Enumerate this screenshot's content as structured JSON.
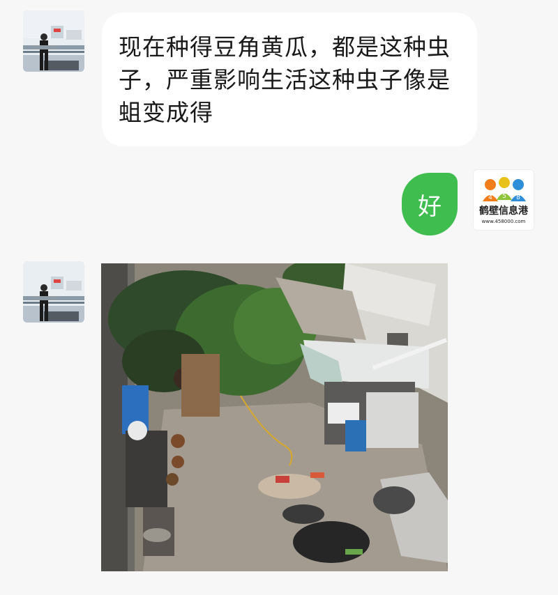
{
  "chat": {
    "messages": [
      {
        "side": "left",
        "type": "text",
        "text": "现在种得豆角黄瓜，都是这种虫子，严重影响生活这种虫子像是蛆变成得"
      },
      {
        "side": "right",
        "type": "text",
        "text": "好"
      },
      {
        "side": "left",
        "type": "image",
        "description_icon": "courtyard-photo"
      }
    ],
    "right_avatar": {
      "logo_digits": [
        "4",
        "5",
        "8"
      ],
      "logo_name": "鹤壁信息港",
      "logo_url": "www.458000.com"
    }
  },
  "colors": {
    "background": "#f7f7f8",
    "bubble_in": "#ffffff",
    "bubble_out": "#3fbd4f"
  }
}
